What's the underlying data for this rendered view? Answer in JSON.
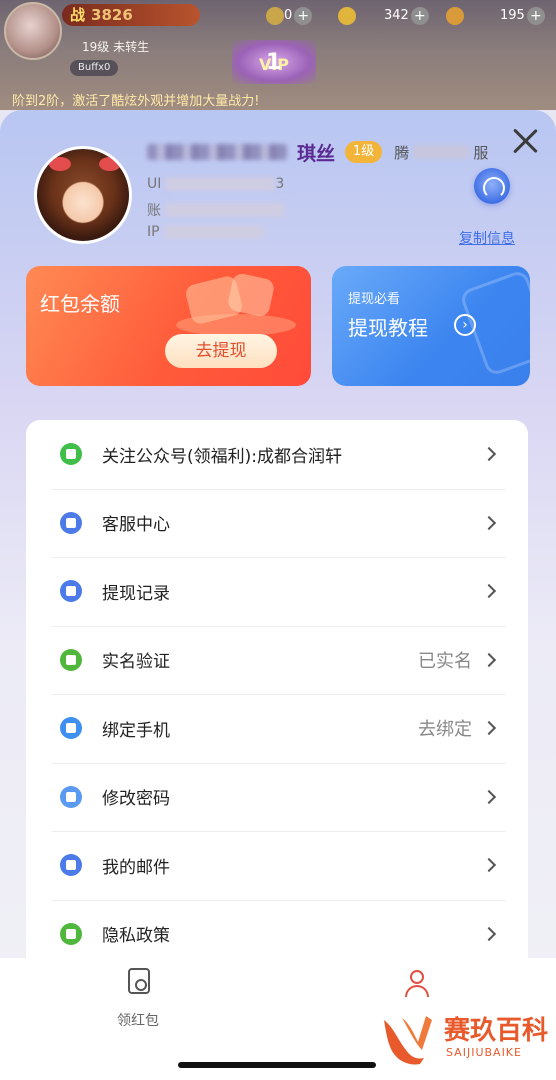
{
  "hud": {
    "power_prefix": "战",
    "power_value": "3826",
    "level_text": "19级 未转生",
    "buff_text": "Buffx0",
    "vip_level": "1",
    "vip_label": "VIP",
    "resource_1": "0",
    "resource_2": "342",
    "resource_3": "195",
    "message": "阶到2阶，激活了酷炫外观并增加大量战力!"
  },
  "profile": {
    "name_visible": "琪丝",
    "level_badge": "1级",
    "server_prefix": "腾",
    "server_suffix": "服",
    "uid_prefix": "UI",
    "uid_suffix": "3",
    "account_prefix": "账",
    "ip_prefix": "IP",
    "copy_label": "复制信息"
  },
  "cards": {
    "balance_title": "红包余额",
    "withdraw_button": "去提现",
    "tutorial_subtitle": "提现必看",
    "tutorial_title": "提现教程"
  },
  "menu": {
    "items": [
      {
        "label": "关注公众号(领福利):成都合润轩",
        "value": "",
        "icon": "wechat-icon",
        "color": "#3fbf4a"
      },
      {
        "label": "客服中心",
        "value": "",
        "icon": "customer-service-icon",
        "color": "#4c7ae8"
      },
      {
        "label": "提现记录",
        "value": "",
        "icon": "record-icon",
        "color": "#4c7ae8"
      },
      {
        "label": "实名验证",
        "value": "已实名",
        "icon": "verified-icon",
        "color": "#4fb83c"
      },
      {
        "label": "绑定手机",
        "value": "去绑定",
        "icon": "phone-icon",
        "color": "#3f8ff0"
      },
      {
        "label": "修改密码",
        "value": "",
        "icon": "edit-password-icon",
        "color": "#5a9af2"
      },
      {
        "label": "我的邮件",
        "value": "",
        "icon": "mail-icon",
        "color": "#4c7ae8"
      },
      {
        "label": "隐私政策",
        "value": "",
        "icon": "privacy-icon",
        "color": "#4fb83c"
      }
    ]
  },
  "bottom_nav": {
    "tab_red_label": "领红包"
  },
  "watermark": {
    "cn": "赛玖百科",
    "en": "SAIJIUBAIKE"
  }
}
